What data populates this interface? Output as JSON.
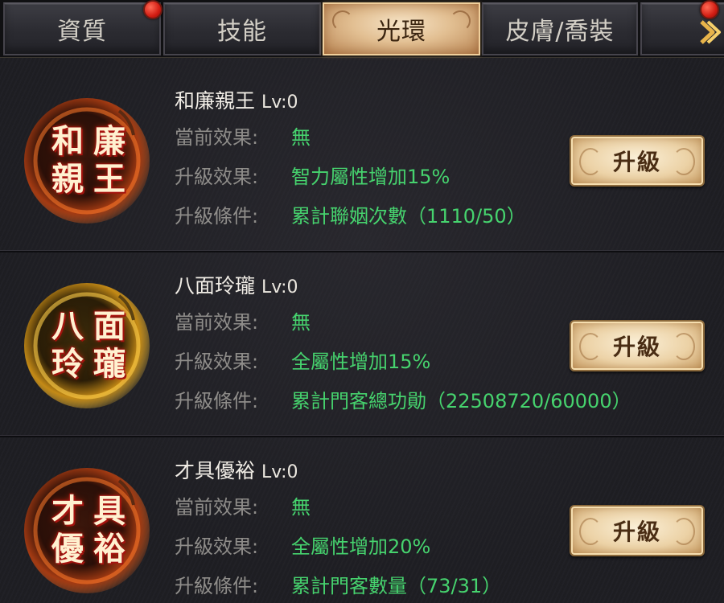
{
  "tabs": [
    {
      "label": "資質",
      "badge": true
    },
    {
      "label": "技能",
      "badge": false
    },
    {
      "label": "光環",
      "badge": false,
      "active": true
    },
    {
      "label": "皮膚/喬裝",
      "badge": false
    },
    {
      "label": "",
      "badge": true
    }
  ],
  "field_labels": {
    "current": "當前效果:",
    "upgrade": "升級效果:",
    "condition": "升級條件:"
  },
  "upgrade_button_label": "升級",
  "auras": [
    {
      "name": "和廉親王",
      "level": "Lv:0",
      "emblem": [
        "和",
        "廉",
        "親",
        "王"
      ],
      "emblem_color": "#c83a14",
      "current_effect": "無",
      "upgrade_effect": "智力屬性增加15%",
      "upgrade_condition": "累計聯姻次數（1110/50）"
    },
    {
      "name": "八面玲瓏",
      "level": "Lv:0",
      "emblem": [
        "八",
        "面",
        "玲",
        "瓏"
      ],
      "emblem_color": "#e3a21e",
      "current_effect": "無",
      "upgrade_effect": "全屬性增加15%",
      "upgrade_condition": "累計門客總功勛（22508720/60000）"
    },
    {
      "name": "才具優裕",
      "level": "Lv:0",
      "emblem": [
        "才",
        "具",
        "優",
        "裕"
      ],
      "emblem_color": "#c83a14",
      "current_effect": "無",
      "upgrade_effect": "全屬性增加20%",
      "upgrade_condition": "累計門客數量（73/31）"
    }
  ],
  "colors": {
    "label": "#8f8d8a",
    "value_green": "#46d36e",
    "active_tab": "#e2bf92",
    "badge_red": "#d21d13"
  }
}
